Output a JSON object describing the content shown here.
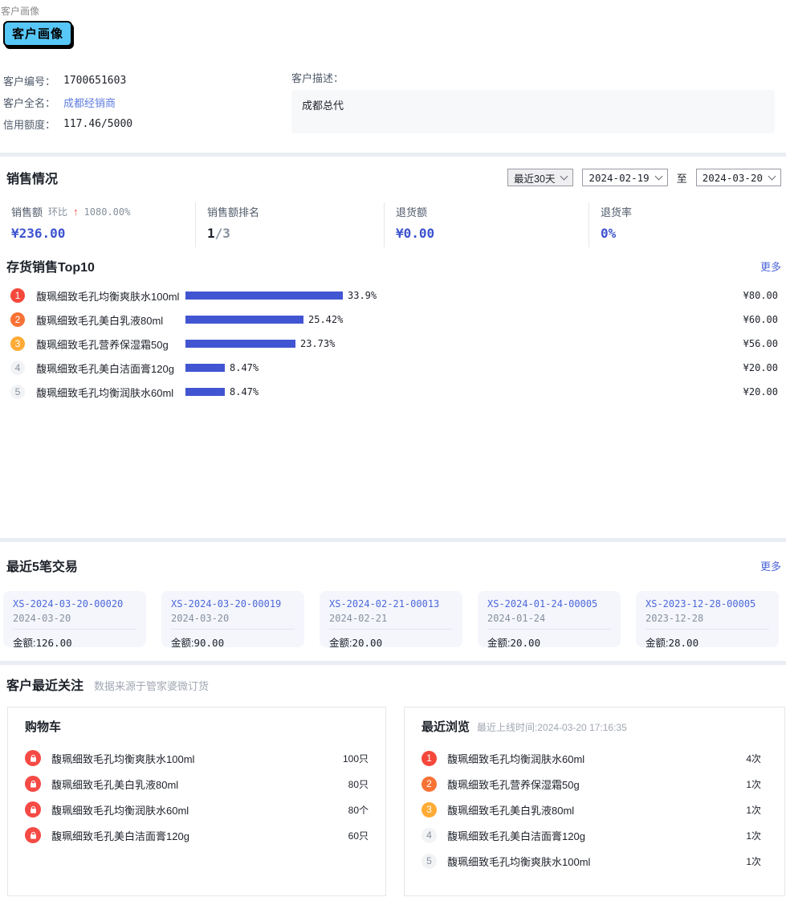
{
  "breadcrumb": "客户画像",
  "tab_label": "客户画像",
  "customer": {
    "id_label": "客户编号：",
    "id": "1700651603",
    "name_label": "客户全名：",
    "name": "成都经销商",
    "credit_label": "信用额度：",
    "credit": "117.46/5000",
    "desc_label": "客户描述：",
    "desc": "成都总代"
  },
  "sales": {
    "title": "销售情况",
    "range_option": "最近30天",
    "date_start": "2024-02-19",
    "to_label": "至",
    "date_end": "2024-03-20",
    "metric1": {
      "label": "销售额",
      "sub": "环比",
      "arrow": "↑",
      "pct": "1080.00%",
      "value": "¥236.00"
    },
    "metric2": {
      "label": "销售额排名",
      "main": "1",
      "suffix": "/3"
    },
    "metric3": {
      "label": "退货额",
      "value": "¥0.00"
    },
    "metric4": {
      "label": "退货率",
      "value": "0%"
    }
  },
  "top10": {
    "title": "存货销售Top10",
    "more_label": "更多",
    "items": [
      {
        "rank": "1",
        "name": "馥珮细致毛孔均衡爽肤水100ml",
        "pct": "33.9%",
        "amount": "¥80.00"
      },
      {
        "rank": "2",
        "name": "馥珮细致毛孔美白乳液80ml",
        "pct": "25.42%",
        "amount": "¥60.00"
      },
      {
        "rank": "3",
        "name": "馥珮细致毛孔营养保湿霜50g",
        "pct": "23.73%",
        "amount": "¥56.00"
      },
      {
        "rank": "4",
        "name": "馥珮细致毛孔美白洁面膏120g",
        "pct": "8.47%",
        "amount": "¥20.00"
      },
      {
        "rank": "5",
        "name": "馥珮细致毛孔均衡润肤水60ml",
        "pct": "8.47%",
        "amount": "¥20.00"
      }
    ]
  },
  "chart_data": {
    "type": "bar",
    "orientation": "horizontal",
    "title": "存货销售Top10",
    "categories": [
      "馥珮细致毛孔均衡爽肤水100ml",
      "馥珮细致毛孔美白乳液80ml",
      "馥珮细致毛孔营养保湿霜50g",
      "馥珮细致毛孔美白洁面膏120g",
      "馥珮细致毛孔均衡润肤水60ml"
    ],
    "values": [
      33.9,
      25.42,
      23.73,
      8.47,
      8.47
    ],
    "value_unit": "%",
    "amounts": [
      "¥80.00",
      "¥60.00",
      "¥56.00",
      "¥20.00",
      "¥20.00"
    ],
    "bar_color": "#4155d2",
    "xlim": [
      0,
      34
    ]
  },
  "transactions": {
    "title": "最近5笔交易",
    "more_label": "更多",
    "amount_label": "金额:",
    "cards": [
      {
        "order_no": "XS-2024-03-20-00020",
        "date": "2024-03-20",
        "amount": "126.00"
      },
      {
        "order_no": "XS-2024-03-20-00019",
        "date": "2024-03-20",
        "amount": "90.00"
      },
      {
        "order_no": "XS-2024-02-21-00013",
        "date": "2024-02-21",
        "amount": "20.00"
      },
      {
        "order_no": "XS-2024-01-24-00005",
        "date": "2024-01-24",
        "amount": "20.00"
      },
      {
        "order_no": "XS-2023-12-28-00005",
        "date": "2023-12-28",
        "amount": "28.00"
      }
    ]
  },
  "focus": {
    "title": "客户最近关注",
    "subtitle": "数据来源于管家婆微订货",
    "cart": {
      "title": "购物车",
      "items": [
        {
          "name": "馥珮细致毛孔均衡爽肤水100ml",
          "qty": "100只"
        },
        {
          "name": "馥珮细致毛孔美白乳液80ml",
          "qty": "80只"
        },
        {
          "name": "馥珮细致毛孔均衡润肤水60ml",
          "qty": "80个"
        },
        {
          "name": "馥珮细致毛孔美白洁面膏120g",
          "qty": "60只"
        }
      ]
    },
    "browse": {
      "title": "最近浏览",
      "subtitle": "最近上线时间:2024-03-20 17:16:35",
      "items": [
        {
          "rank": "1",
          "name": "馥珮细致毛孔均衡润肤水60ml",
          "count": "4次"
        },
        {
          "rank": "2",
          "name": "馥珮细致毛孔营养保湿霜50g",
          "count": "1次"
        },
        {
          "rank": "3",
          "name": "馥珮细致毛孔美白乳液80ml",
          "count": "1次"
        },
        {
          "rank": "4",
          "name": "馥珮细致毛孔美白洁面膏120g",
          "count": "1次"
        },
        {
          "rank": "5",
          "name": "馥珮细致毛孔均衡爽肤水100ml",
          "count": "1次"
        }
      ]
    }
  },
  "colors": {
    "tab_blue": "#57c7f8",
    "accent_value_blue": "#3d53cf",
    "link_blue": "#5e7ce0",
    "more_link_blue": "#4e65d9",
    "bar_blue": "#4155d2",
    "rank1_red": "#f5483b",
    "rank2_orange": "#f77234",
    "rank3_amber": "#ffab36",
    "rank_default_bg": "#f2f3f5",
    "rank_default_text": "#86909c",
    "up_arrow_red": "#f5483b",
    "cart_icon_red": "#f54a45",
    "card_bg": "#f4f6fc",
    "divider": "#e9edf4"
  }
}
